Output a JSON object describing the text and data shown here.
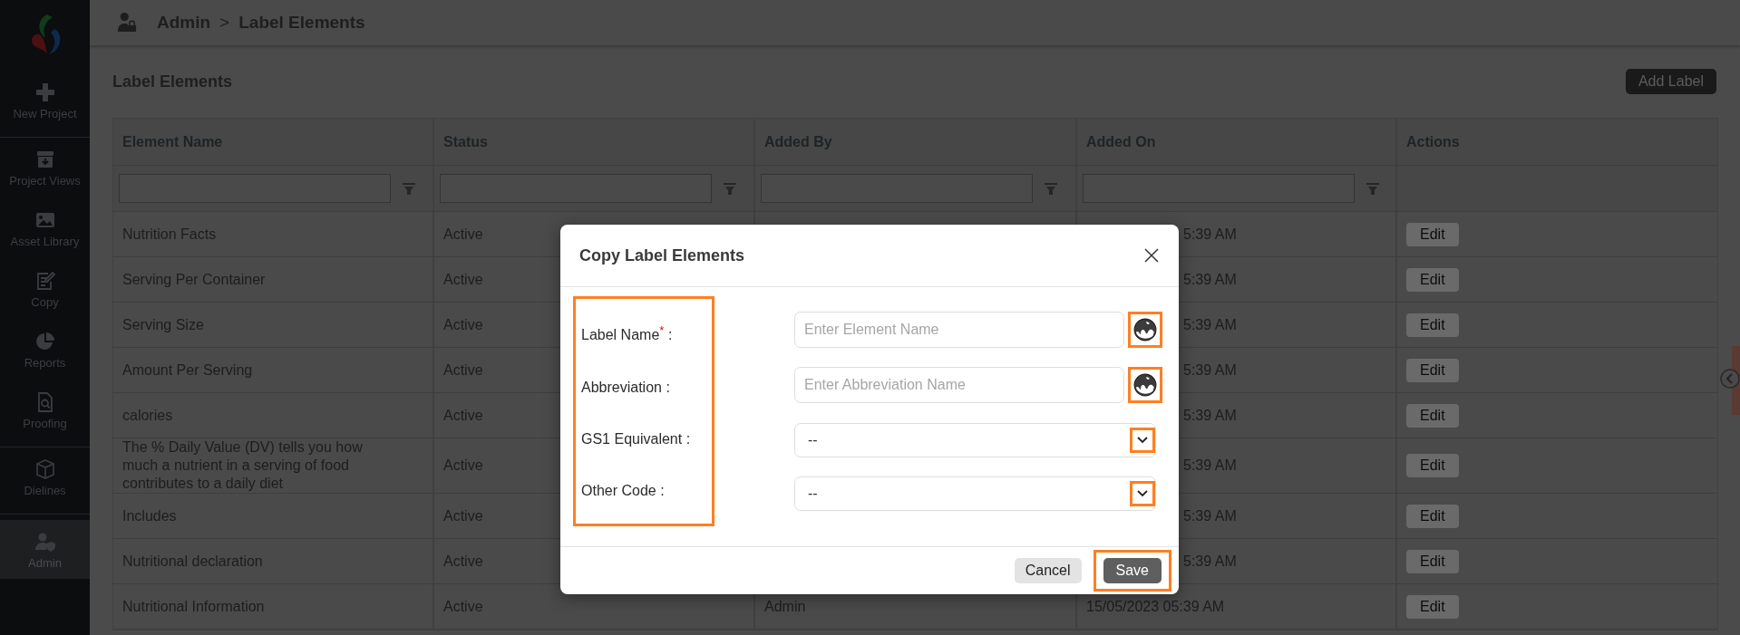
{
  "sidebar": {
    "groups": [
      [
        {
          "label": "New Project",
          "selected": false
        }
      ],
      [
        {
          "label": "Project Views",
          "selected": false
        },
        {
          "label": "Asset Library",
          "selected": false
        },
        {
          "label": "Copy",
          "selected": false
        },
        {
          "label": "Reports",
          "selected": false
        },
        {
          "label": "Proofing",
          "selected": false
        }
      ],
      [
        {
          "label": "Dielines",
          "selected": false
        }
      ],
      [
        {
          "label": "Admin",
          "selected": true
        }
      ]
    ]
  },
  "breadcrumb": {
    "section": "Admin",
    "separator": ">",
    "page": "Label Elements"
  },
  "page_title": "Label Elements",
  "add_button": "Add Label",
  "table": {
    "columns": [
      {
        "title": "Element Name"
      },
      {
        "title": "Status"
      },
      {
        "title": "Added By"
      },
      {
        "title": "Added On"
      },
      {
        "title": "Actions"
      }
    ],
    "rows": [
      {
        "element_name": "Nutrition Facts",
        "status": "Active",
        "added_on": "5:39 AM",
        "clipped": true,
        "action": "Edit"
      },
      {
        "element_name": "Serving Per Container",
        "status": "Active",
        "added_on": "5:39 AM",
        "clipped": true,
        "action": "Edit"
      },
      {
        "element_name": "Serving Size",
        "status": "Active",
        "added_on": "5:39 AM",
        "clipped": true,
        "action": "Edit"
      },
      {
        "element_name": "Amount Per Serving",
        "status": "Active",
        "added_on": "5:39 AM",
        "clipped": true,
        "action": "Edit"
      },
      {
        "element_name": "calories",
        "status": "Active",
        "added_on": "5:39 AM",
        "clipped": true,
        "action": "Edit"
      },
      {
        "element_name": "The % Daily Value (DV) tells you how much a nutrient in a serving of food contributes to a daily diet",
        "status": "Active",
        "added_on": "5:39 AM",
        "clipped": true,
        "action": "Edit"
      },
      {
        "element_name": "Includes",
        "status": "Active",
        "added_on": "5:39 AM",
        "clipped": true,
        "action": "Edit"
      },
      {
        "element_name": "Nutritional declaration",
        "status": "Active",
        "added_on": "5:39 AM",
        "clipped": true,
        "action": "Edit"
      },
      {
        "element_name": "Nutritional Information",
        "status": "Active",
        "added_by": "Admin",
        "added_on": "15/05/2023 05:39 AM",
        "clipped": false,
        "action": "Edit"
      }
    ]
  },
  "modal": {
    "title": "Copy Label Elements",
    "labels_highlighted": true,
    "fields": [
      {
        "label": "Label Name$^{*}$ :",
        "kind": "text",
        "placeholder": "Enter Element Name",
        "highlighted": true
      },
      {
        "label": "Abbreviation :",
        "kind": "text",
        "placeholder": "Enter Abbreviation Name",
        "highlighted": true
      },
      {
        "label": "GS1 Equivalent :",
        "kind": "select",
        "value": "--",
        "highlighted": true
      },
      {
        "label": "Other Code :",
        "kind": "select",
        "value": "--",
        "highlighted": true
      }
    ],
    "buttons": [
      {
        "label": "Cancel",
        "kind": "secondary",
        "highlighted": false
      },
      {
        "label": "Save",
        "kind": "primary",
        "highlighted": true
      }
    ]
  }
}
